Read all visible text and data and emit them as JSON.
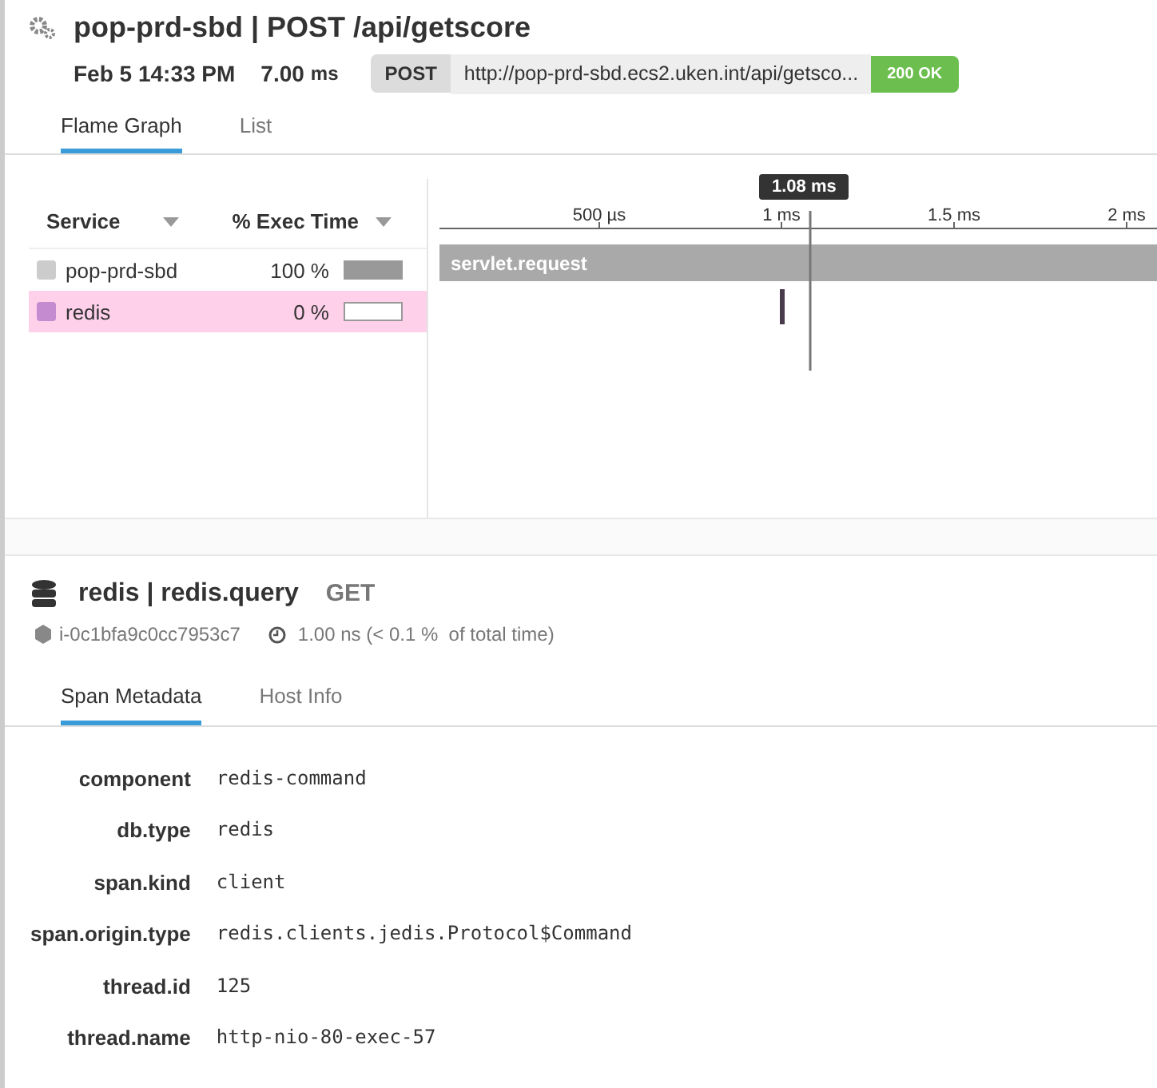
{
  "header": {
    "title": "pop-prd-sbd | POST /api/getscore",
    "date": "Feb 5 14:33 PM",
    "duration": "7.00",
    "duration_unit": "ms",
    "method": "POST",
    "url": "http://pop-prd-sbd.ecs2.uken.int/api/getsco...",
    "status": "200 OK"
  },
  "tabs": [
    {
      "label": "Flame Graph",
      "selected": true
    },
    {
      "label": "List",
      "selected": false
    }
  ],
  "services": {
    "columns": [
      "Service",
      "% Exec Time"
    ],
    "rows": [
      {
        "name": "pop-prd-sbd",
        "percent": "100 %",
        "level": 1,
        "color": "#cccccc",
        "selected": false
      },
      {
        "name": "redis",
        "percent": "0 %",
        "level": 0,
        "color": "#c48bd0",
        "selected": true
      }
    ]
  },
  "timeline": {
    "ticks": [
      "500 µs",
      "1 ms",
      "1.5 ms",
      "2 ms"
    ],
    "cursor": "1.08 ms",
    "span": "servlet.request"
  },
  "span": {
    "title": "redis | redis.query",
    "method": "GET",
    "host": "i-0c1bfa9c0cc7953c7",
    "time": "1.00 ns (< 0.1 %  of total time)"
  },
  "detail_tabs": [
    {
      "label": "Span Metadata",
      "selected": true
    },
    {
      "label": "Host Info",
      "selected": false
    }
  ],
  "metadata": [
    {
      "key": "component",
      "value": "redis-command"
    },
    {
      "key": "db.type",
      "value": "redis"
    },
    {
      "key": "span.kind",
      "value": "client"
    },
    {
      "key": "span.origin.type",
      "value": "redis.clients.jedis.Protocol$Command"
    },
    {
      "key": "thread.id",
      "value": "125"
    },
    {
      "key": "thread.name",
      "value": "http-nio-80-exec-57"
    }
  ]
}
